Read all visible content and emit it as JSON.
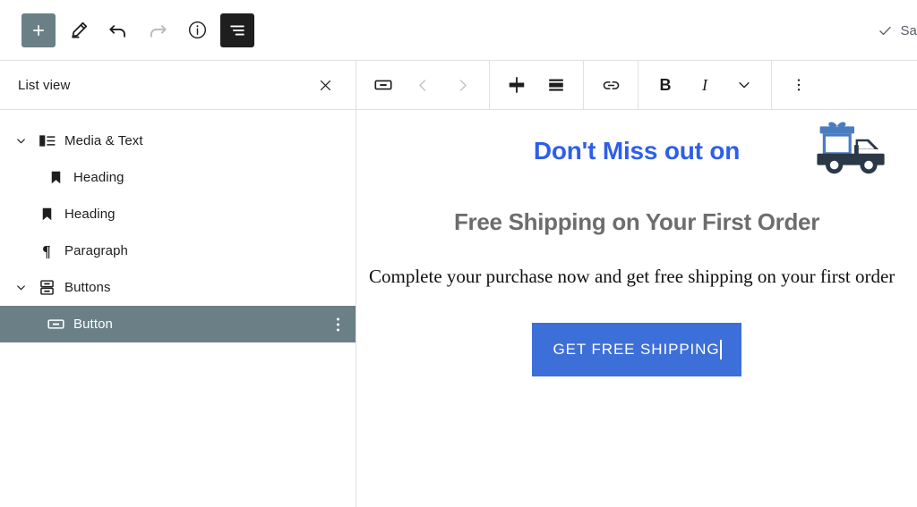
{
  "topbar": {
    "buttons": [
      {
        "name": "block-inserter-button",
        "icon": "plus-icon",
        "label": "Add block"
      },
      {
        "name": "tools-button",
        "icon": "pencil-icon",
        "label": "Tools"
      },
      {
        "name": "undo-button",
        "icon": "undo-arrow-icon",
        "label": "Undo"
      },
      {
        "name": "redo-button",
        "icon": "redo-arrow-icon",
        "label": "Redo"
      },
      {
        "name": "details-button",
        "icon": "info-circle-icon",
        "label": "Details"
      },
      {
        "name": "list-view-toggle-button",
        "icon": "list-view-icon",
        "label": "List view"
      }
    ],
    "save_status": "Sa",
    "save_status_icon": "checkmark-icon"
  },
  "list_view": {
    "title": "List view",
    "close_label": "Close",
    "items": [
      {
        "label": "Media & Text",
        "icon": "media-text-icon",
        "indent": 0,
        "expandable": true,
        "selected": false
      },
      {
        "label": "Heading",
        "icon": "heading-icon",
        "indent": 1,
        "expandable": false,
        "selected": false
      },
      {
        "label": "Heading",
        "icon": "heading-icon",
        "indent": 0,
        "expandable": false,
        "selected": false
      },
      {
        "label": "Paragraph",
        "icon": "paragraph-pilcrow-icon",
        "indent": 0,
        "expandable": false,
        "selected": false
      },
      {
        "label": "Buttons",
        "icon": "buttons-stack-icon",
        "indent": 0,
        "expandable": true,
        "selected": false
      },
      {
        "label": "Button",
        "icon": "button-icon",
        "indent": 1,
        "expandable": false,
        "selected": true
      }
    ],
    "selected_row_options_label": "Options"
  },
  "block_toolbar": {
    "groups": [
      {
        "buttons": [
          {
            "name": "block-type-button",
            "icon": "button-block-icon",
            "label": "Button"
          },
          {
            "name": "move-left-button",
            "icon": "chevron-left-icon",
            "label": "Move left",
            "disabled": true
          },
          {
            "name": "move-right-button",
            "icon": "chevron-right-icon",
            "label": "Move right",
            "disabled": true
          }
        ]
      },
      {
        "buttons": [
          {
            "name": "drag-handle-button",
            "icon": "drag-handle-icon",
            "label": "Drag"
          },
          {
            "name": "align-button",
            "icon": "align-justify-icon",
            "label": "Align"
          }
        ]
      },
      {
        "buttons": [
          {
            "name": "link-button",
            "icon": "link-icon",
            "label": "Link"
          }
        ]
      },
      {
        "buttons": [
          {
            "name": "bold-button",
            "icon": "bold-icon",
            "label": "B"
          },
          {
            "name": "italic-button",
            "icon": "italic-icon",
            "label": "I"
          },
          {
            "name": "more-formatting-button",
            "icon": "chevron-down-icon",
            "label": "More"
          }
        ]
      },
      {
        "buttons": [
          {
            "name": "block-options-button",
            "icon": "vertical-dots-icon",
            "label": "Options"
          }
        ]
      }
    ]
  },
  "canvas": {
    "hero_heading": "Don't Miss out on",
    "truck_icon": "delivery-truck-gift-icon",
    "sub_heading": "Free Shipping on Your First Order",
    "paragraph": "Complete your purchase now and get free shipping on your first order",
    "cta_label": "GET FREE SHIPPING"
  },
  "colors": {
    "accent_blue": "#2e5fe8",
    "cta_blue": "#3d6fd8",
    "selected_slate": "#6b7f87",
    "subheading_gray": "#6d6d6d",
    "toolbar_dark": "#1e1e1e",
    "truck_body": "#2b3848",
    "gift_blue": "#4a7cc0"
  }
}
